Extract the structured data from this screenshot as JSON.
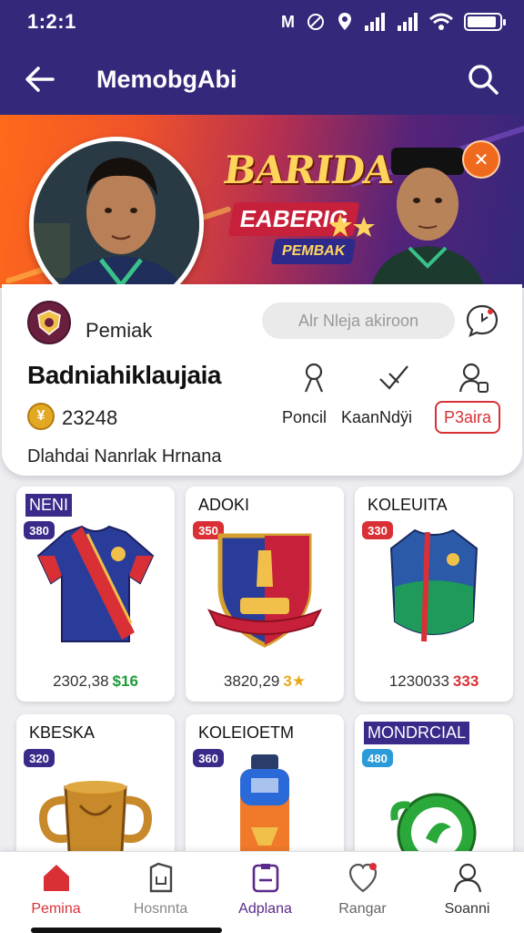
{
  "status_bar": {
    "time": "1:2:1",
    "icons_text": "M",
    "battery_level": 0.9
  },
  "app_bar": {
    "title": "MemobgAbi"
  },
  "banner": {
    "title": "BARIDA",
    "subtitle1": "EABERIG",
    "subtitle2": "PEMBAK"
  },
  "profile": {
    "club_name": "Pemiak",
    "search_placeholder": "Alr Nleja akiroon",
    "name": "Badniahiklaujaia",
    "coins": "23248",
    "actions": [
      {
        "label": "Poncil",
        "icon": "person-icon"
      },
      {
        "label": "KaanNdÿi",
        "icon": "share-icon"
      },
      {
        "label": "",
        "icon": "user-check-icon"
      }
    ],
    "follow_label": "P3aira",
    "bio": "Dlahdai Nanrlak Hrnana"
  },
  "items": [
    {
      "title": "NENI",
      "tagged": true,
      "badge": "380",
      "badge_color": "#3a2a8a",
      "price": "2302,38",
      "accent": "$16",
      "accent_color": "#1f9a3a",
      "art": "jersey"
    },
    {
      "title": "ADOKI",
      "tagged": false,
      "badge": "350",
      "badge_color": "#d93036",
      "price": "3820,29",
      "accent": "3★",
      "accent_color": "#e8a81a",
      "art": "crest"
    },
    {
      "title": "KOLEUITA",
      "tagged": false,
      "badge": "330",
      "badge_color": "#d93036",
      "price": "1230033",
      "accent": "333",
      "accent_color": "#d93036",
      "art": "shirt"
    },
    {
      "title": "KBESKA",
      "tagged": false,
      "badge": "320",
      "badge_color": "#3a2a8a",
      "price": "",
      "accent": "",
      "accent_color": "#333",
      "art": "trophy"
    },
    {
      "title": "KOLEIOETM",
      "tagged": false,
      "badge": "360",
      "badge_color": "#3a2a8a",
      "price": "",
      "accent": "",
      "accent_color": "#333",
      "art": "bottle"
    },
    {
      "title": "MONDRCIAL",
      "tagged": true,
      "badge": "480",
      "badge_color": "#2a9ad8",
      "price": "",
      "accent": "",
      "accent_color": "#333",
      "art": "orb"
    }
  ],
  "bottom_nav": [
    {
      "label": "Pemina",
      "active": true,
      "color": "#d93036",
      "icon": "home-icon"
    },
    {
      "label": "Hosnnta",
      "active": false,
      "color": "#888888",
      "icon": "card-icon"
    },
    {
      "label": "Adplana",
      "active": false,
      "color": "#5a2a8a",
      "icon": "badge-icon"
    },
    {
      "label": "Rangar",
      "active": false,
      "color": "#666666",
      "icon": "heart-pin-icon"
    },
    {
      "label": "Soanni",
      "active": false,
      "color": "#333333",
      "icon": "user-icon"
    }
  ]
}
